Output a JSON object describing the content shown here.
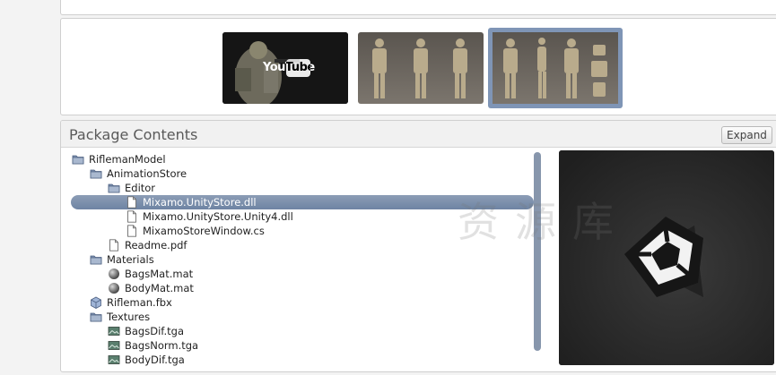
{
  "thumbnails": [
    {
      "name": "video-thumbnail",
      "badge": "YouTube",
      "selected": false
    },
    {
      "name": "model-front-thumbnail",
      "selected": false
    },
    {
      "name": "model-overview-thumbnail",
      "selected": true
    }
  ],
  "package": {
    "title": "Package Contents",
    "expand_label": "Expand",
    "tree": [
      {
        "label": "RiflemanModel",
        "icon": "folder-icon",
        "depth": 0
      },
      {
        "label": "AnimationStore",
        "icon": "folder-icon",
        "depth": 1
      },
      {
        "label": "Editor",
        "icon": "folder-icon",
        "depth": 2
      },
      {
        "label": "Mixamo.UnityStore.dll",
        "icon": "file-icon",
        "depth": 3,
        "selected": true
      },
      {
        "label": "Mixamo.UnityStore.Unity4.dll",
        "icon": "file-icon",
        "depth": 3
      },
      {
        "label": "MixamoStoreWindow.cs",
        "icon": "file-icon",
        "depth": 3
      },
      {
        "label": "Readme.pdf",
        "icon": "file-icon",
        "depth": 2
      },
      {
        "label": "Materials",
        "icon": "folder-icon",
        "depth": 1
      },
      {
        "label": "BagsMat.mat",
        "icon": "material-sphere-icon",
        "depth": 2
      },
      {
        "label": "BodyMat.mat",
        "icon": "material-sphere-icon",
        "depth": 2
      },
      {
        "label": "Rifleman.fbx",
        "icon": "model-cube-icon",
        "depth": 1
      },
      {
        "label": "Textures",
        "icon": "folder-icon",
        "depth": 1
      },
      {
        "label": "BagsDif.tga",
        "icon": "image-icon",
        "depth": 2
      },
      {
        "label": "BagsNorm.tga",
        "icon": "image-icon",
        "depth": 2
      },
      {
        "label": "BodyDif.tga",
        "icon": "image-icon",
        "depth": 2
      }
    ]
  },
  "preview": {
    "icon": "unity-logo-icon"
  },
  "colors": {
    "selection": "#7f95b6",
    "scrollbar": "#8796ac",
    "preview_bg": "#2d2d2d"
  }
}
